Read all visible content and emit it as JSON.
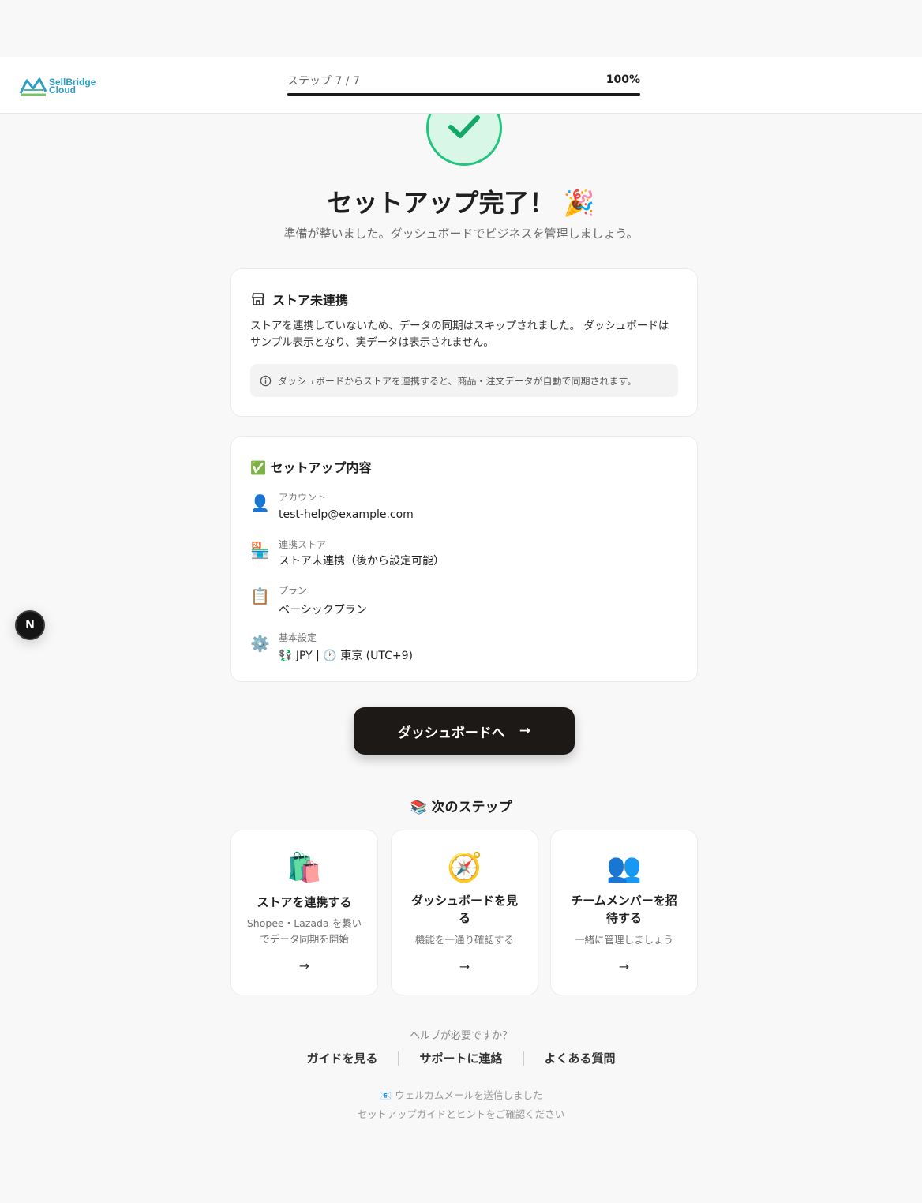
{
  "brand": {
    "line1": "SellBridge",
    "line2": "Cloud"
  },
  "progress": {
    "label": "ステップ 7 / 7",
    "percent_text": "100%",
    "fraction": 1.0
  },
  "hero": {
    "title": "セットアップ完了！ 🎉",
    "subtitle": "準備が整いました。ダッシュボードでビジネスを管理しましょう。"
  },
  "store_card": {
    "heading": "ストア未連携",
    "description": "ストアを連携していないため、データの同期はスキップされました。 ダッシュボードはサンプル表示となり、実データは表示されません。",
    "info": "ダッシュボードからストアを連携すると、商品・注文データが自動で同期されます。"
  },
  "summary": {
    "heading": "✅ セットアップ内容",
    "items": [
      {
        "icon": "👤",
        "label": "アカウント",
        "value": "test-help@example.com"
      },
      {
        "icon": "🏪",
        "label": "連携ストア",
        "value": "ストア未連携（後から設定可能）"
      },
      {
        "icon": "📋",
        "label": "プラン",
        "value": "ベーシックプラン"
      },
      {
        "icon": "⚙️",
        "label": "基本設定",
        "value": "💱 JPY | 🕐 東京 (UTC+9)"
      }
    ]
  },
  "cta": {
    "label": "ダッシュボードへ",
    "arrow": "→"
  },
  "next_steps": {
    "heading": "📚 次のステップ",
    "cards": [
      {
        "icon": "🛍️",
        "title": "ストアを連携する",
        "desc": "Shopee・Lazada を繋いでデータ同期を開始",
        "arrow": "→"
      },
      {
        "icon": "🧭",
        "title": "ダッシュボードを見る",
        "desc": "機能を一通り確認する",
        "arrow": "→"
      },
      {
        "icon": "👥",
        "title": "チームメンバーを招待する",
        "desc": "一緒に管理しましょう",
        "arrow": "→"
      }
    ]
  },
  "help": {
    "question": "ヘルプが必要ですか？",
    "links": [
      "ガイドを見る",
      "サポートに連絡",
      "よくある質問"
    ]
  },
  "mail_notice": {
    "line1": "📧 ウェルカムメールを送信しました",
    "line2": "セットアップガイドとヒントをご確認ください"
  },
  "floating_badge": {
    "letter": "N"
  },
  "colors": {
    "accent_green": "#23c47e",
    "button_dark": "#1d1917"
  }
}
